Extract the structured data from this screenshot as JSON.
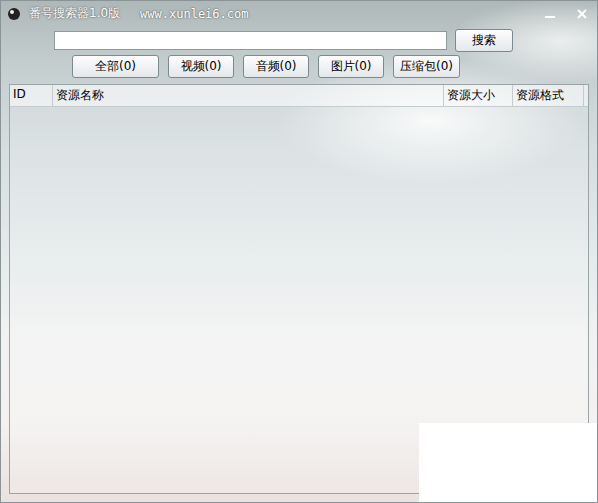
{
  "window": {
    "title": "番号搜索器1.0版",
    "site": "www.xunlei6.com"
  },
  "search": {
    "value": "",
    "button": "搜索"
  },
  "filters": [
    {
      "label": "全部(0)",
      "selected": false
    },
    {
      "label": "视频(0)",
      "selected": false
    },
    {
      "label": "音频(0)",
      "selected": false
    },
    {
      "label": "图片(0)",
      "selected": false
    },
    {
      "label": "压缩包(0)",
      "selected": false
    }
  ],
  "table": {
    "columns": [
      "ID",
      "资源名称",
      "资源大小",
      "资源格式"
    ],
    "rows": []
  }
}
